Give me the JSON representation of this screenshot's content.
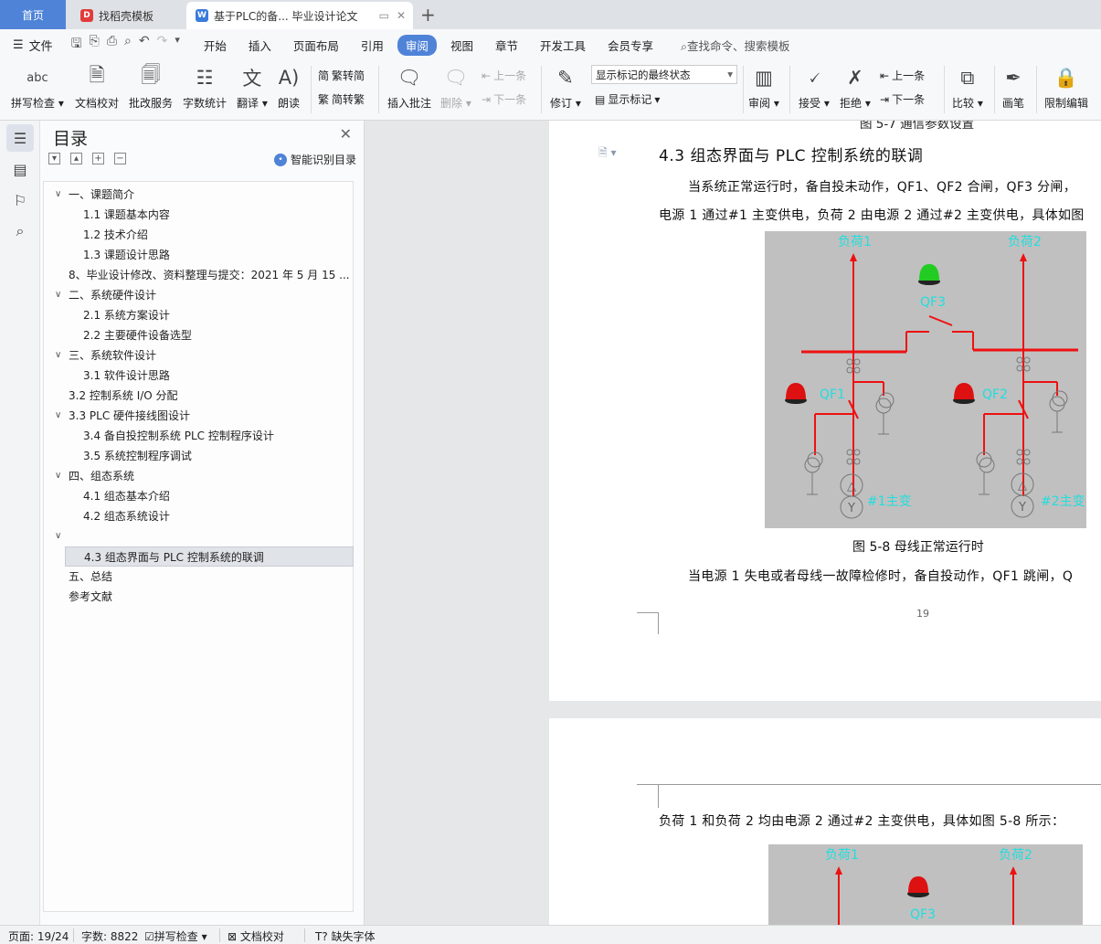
{
  "tabs": {
    "home": "首页",
    "template": "找稻壳模板",
    "document": "基于PLC的备... 毕业设计论文"
  },
  "menu": {
    "file": "文件",
    "items": [
      "开始",
      "插入",
      "页面布局",
      "引用",
      "审阅",
      "视图",
      "章节",
      "开发工具",
      "会员专享"
    ],
    "active": "审阅",
    "search": "查找命令、搜索模板"
  },
  "ribbon": {
    "spell_check": "拼写检查",
    "doc_proof": "文档校对",
    "review_service": "批改服务",
    "word_count": "字数统计",
    "translate": "翻译",
    "read_aloud": "朗读",
    "trad_to_simp": "繁转简",
    "simp_to_trad": "简转繁",
    "insert_comment": "插入批注",
    "delete": "删除",
    "prev_comment": "上一条",
    "next_comment": "下一条",
    "track_changes": "修订",
    "markup_state": "显示标记的最终状态",
    "show_markup": "显示标记",
    "review_pane": "审阅",
    "accept": "接受",
    "reject": "拒绝",
    "prev_change": "上一条",
    "next_change": "下一条",
    "compare": "比较",
    "pen": "画笔",
    "restrict_edit": "限制编辑"
  },
  "toc": {
    "title": "目录",
    "smart": "智能识别目录",
    "items": [
      {
        "text": "一、课题简介",
        "level": 1,
        "chev": true
      },
      {
        "text": "1.1  课题基本内容",
        "level": 2
      },
      {
        "text": "1.2  技术介绍",
        "level": 2
      },
      {
        "text": "1.3  课题设计思路",
        "level": 2
      },
      {
        "text": "8、毕业设计修改、资料整理与提交：2021 年 5 月 15 ...",
        "level": 1
      },
      {
        "text": "二、系统硬件设计",
        "level": 1,
        "chev": true
      },
      {
        "text": "2.1  系统方案设计",
        "level": 2
      },
      {
        "text": "2.2  主要硬件设备选型",
        "level": 2
      },
      {
        "text": "三、系统软件设计",
        "level": 1,
        "chev": true
      },
      {
        "text": "3.1  软件设计思路",
        "level": 2
      },
      {
        "text": "3.2  控制系统 I/O 分配",
        "level": 1
      },
      {
        "text": "3.3 PLC 硬件接线图设计",
        "level": 1,
        "chev": true
      },
      {
        "text": "3.4 备自投控制系统 PLC 控制程序设计",
        "level": 2
      },
      {
        "text": "3.5 系统控制程序调试",
        "level": 2
      },
      {
        "text": "四、组态系统",
        "level": 1,
        "chev": true
      },
      {
        "text": "4.1  组态基本介绍",
        "level": 2
      },
      {
        "text": "4.2 组态系统设计",
        "level": 2
      },
      {
        "text": "",
        "level": 1,
        "chev": true
      },
      {
        "text": "4.3 组态界面与 PLC 控制系统的联调",
        "level": 2,
        "selected": true
      },
      {
        "text": "五、总结",
        "level": 1
      },
      {
        "text": "参考文献",
        "level": 1
      }
    ]
  },
  "doc": {
    "prev_caption": "图 5-7  通信参数设置",
    "heading": "4.3 组态界面与 PLC 控制系统的联调",
    "para1": "当系统正常运行时，备自投未动作，QF1、QF2 合闸，QF3 分闸，",
    "para2": "电源 1 通过#1 主变供电，负荷 2 由电源 2 通过#2 主变供电，具体如图",
    "caption": "图 5-8  母线正常运行时",
    "para3": "当电源 1 失电或者母线一故障检修时，备自投动作，QF1 跳闸，Q",
    "page_number": "19",
    "page2_para": "负荷 1 和负荷 2 均由电源 2 通过#2 主变供电，具体如图 5-8 所示：",
    "fig": {
      "load1": "负荷1",
      "load2": "负荷2",
      "qf1": "QF1",
      "qf2": "QF2",
      "qf3": "QF3",
      "t1": "#1主变",
      "t2": "#2主变",
      "delta": "△",
      "wye": "Y"
    }
  },
  "status": {
    "page": "页面: 19/24",
    "words": "字数: 8822",
    "spell": "拼写检查",
    "proof": "文档校对",
    "missing_font": "缺失字体"
  },
  "colors": {
    "accent": "#4f83d8",
    "bus_red": "#ee1111",
    "label_cyan": "#22dddd",
    "indicator_green": "#22cc22",
    "indicator_red": "#dd1111"
  }
}
